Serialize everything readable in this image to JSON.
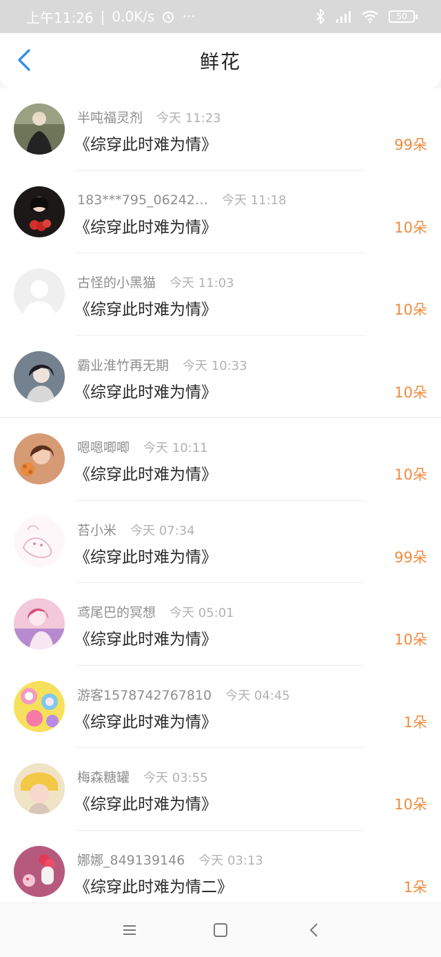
{
  "status_bar": {
    "time": "上午11:26",
    "net_speed": "0.0K/s",
    "dots": "···",
    "battery": "50",
    "icons": [
      "alarm-icon",
      "bluetooth-icon",
      "signal-icon",
      "wifi-icon",
      "battery-icon"
    ]
  },
  "header": {
    "title": "鲜花",
    "back_icon": "back-chevron-icon"
  },
  "rows": [
    {
      "name": "半吨福灵剂",
      "time": "今天 11:23",
      "book": "《综穿此时难为情》",
      "amount": "99朵"
    },
    {
      "name": "183***795_06242…",
      "time": "今天 11:18",
      "book": "《综穿此时难为情》",
      "amount": "10朵"
    },
    {
      "name": "古怪的小黑猫",
      "time": "今天 11:03",
      "book": "《综穿此时难为情》",
      "amount": "10朵"
    },
    {
      "name": "霸业淮竹再无期",
      "time": "今天 10:33",
      "book": "《综穿此时难为情》",
      "amount": "10朵"
    },
    {
      "name": "嗯嗯唧唧",
      "time": "今天 10:11",
      "book": "《综穿此时难为情》",
      "amount": "10朵"
    },
    {
      "name": "苔小米",
      "time": "今天 07:34",
      "book": "《综穿此时难为情》",
      "amount": "99朵"
    },
    {
      "name": "鸢尾巴的冥想",
      "time": "今天 05:01",
      "book": "《综穿此时难为情》",
      "amount": "10朵"
    },
    {
      "name": "游客1578742767810",
      "time": "今天 04:45",
      "book": "《综穿此时难为情》",
      "amount": "1朵"
    },
    {
      "name": "梅森糖罐",
      "time": "今天 03:55",
      "book": "《综穿此时难为情》",
      "amount": "10朵"
    },
    {
      "name": "娜娜_849139146",
      "time": "今天 03:13",
      "book": "《综穿此时难为情二》",
      "amount": "1朵"
    }
  ],
  "nav_bar": {
    "icons": [
      "menu-icon",
      "home-square-icon",
      "back-triangle-icon"
    ]
  },
  "colors": {
    "accent": "#2f8ff0",
    "amount": "#f08a3e",
    "status_bar_bg": "#d9d9d9"
  }
}
